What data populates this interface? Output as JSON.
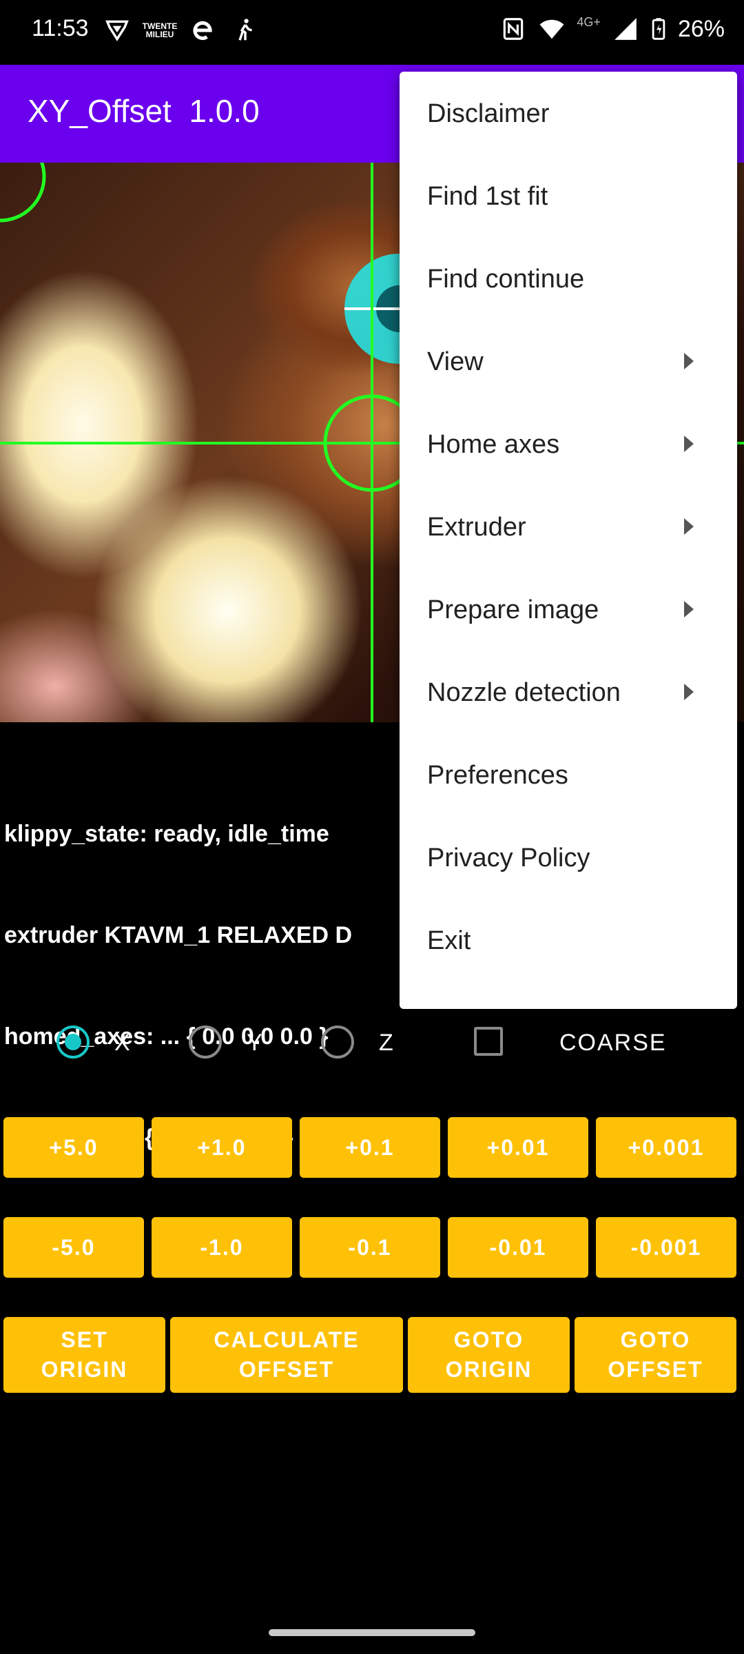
{
  "status_bar": {
    "time": "11:53",
    "network_label": "4G+",
    "battery": "26%",
    "icons": [
      "vpn-shield-icon",
      "twente-milieu-icon",
      "e-app-icon",
      "walking-person-icon",
      "nfc-icon",
      "wifi-icon",
      "cell-signal-icon",
      "battery-charging-icon"
    ],
    "mini_logo_text": "TWENTE MILIEU"
  },
  "appbar": {
    "title": "XY_Offset  1.0.0",
    "color": "#6a00ee"
  },
  "info": {
    "lines": [
      "klippy_state: ready, idle_time",
      "extruder KTAVM_1 RELAXED D",
      "homed_axes: ... { 0.0 0.0 0.0 }",
      "Bitmap XYR { 345 125 50 }"
    ]
  },
  "selector": {
    "radios": [
      {
        "label": "X",
        "checked": true
      },
      {
        "label": "Y",
        "checked": false
      },
      {
        "label": "Z",
        "checked": false
      }
    ],
    "coarse_label": "COARSE",
    "coarse_checked": false
  },
  "buttons": {
    "plus": [
      "+5.0",
      "+1.0",
      "+0.1",
      "+0.01",
      "+0.001"
    ],
    "minus": [
      "-5.0",
      "-1.0",
      "-0.1",
      "-0.01",
      "-0.001"
    ],
    "actions": [
      {
        "line1": "SET",
        "line2": "ORIGIN"
      },
      {
        "line1": "CALCULATE",
        "line2": "OFFSET"
      },
      {
        "line1": "GOTO",
        "line2": "ORIGIN"
      },
      {
        "line1": "GOTO",
        "line2": "OFFSET"
      }
    ],
    "color": "#ffc107"
  },
  "menu": {
    "items": [
      {
        "label": "Disclaimer",
        "submenu": false
      },
      {
        "label": "Find 1st fit",
        "submenu": false
      },
      {
        "label": "Find continue",
        "submenu": false
      },
      {
        "label": "View",
        "submenu": true
      },
      {
        "label": "Home axes",
        "submenu": true
      },
      {
        "label": "Extruder",
        "submenu": true
      },
      {
        "label": "Prepare image",
        "submenu": true
      },
      {
        "label": "Nozzle detection",
        "submenu": true
      },
      {
        "label": "Preferences",
        "submenu": false
      },
      {
        "label": "Privacy Policy",
        "submenu": false
      },
      {
        "label": "Exit",
        "submenu": false
      }
    ]
  },
  "overlay_colors": {
    "crosshair": "#22ff22",
    "target": "#27e0e0"
  }
}
